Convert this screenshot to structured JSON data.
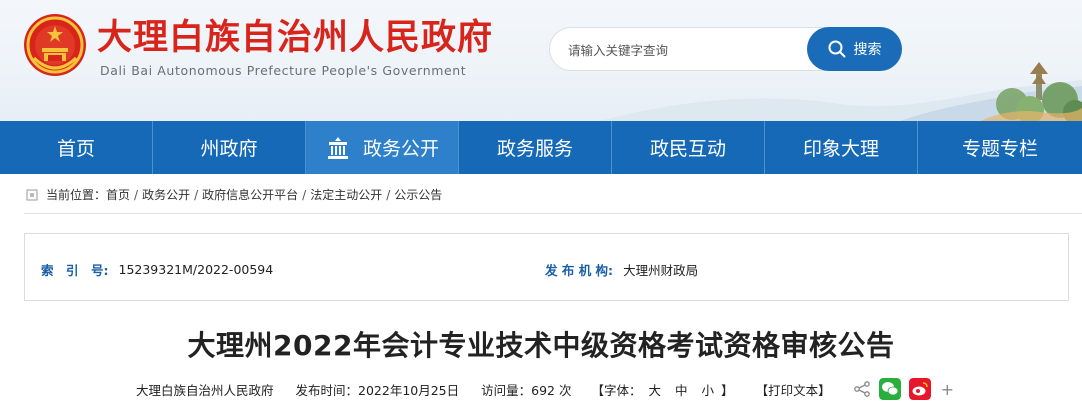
{
  "header": {
    "site_title": "大理白族自治州人民政府",
    "site_subtitle": "Dali Bai Autonomous Prefecture People's Government",
    "emblem_icon": "national-emblem-icon"
  },
  "search": {
    "placeholder": "请输入关键字查询",
    "button_label": "搜索",
    "icon": "search-icon"
  },
  "nav": {
    "items": [
      {
        "label": "首页"
      },
      {
        "label": "州政府"
      },
      {
        "label": "政务公开",
        "active": true,
        "icon": "government-building-icon"
      },
      {
        "label": "政务服务"
      },
      {
        "label": "政民互动"
      },
      {
        "label": "印象大理"
      },
      {
        "label": "专题专栏"
      }
    ]
  },
  "breadcrumb": {
    "prefix": "当前位置：",
    "items": [
      "首页",
      "政务公开",
      "政府信息公开平台",
      "法定主动公开",
      "公示公告"
    ],
    "separator": "/"
  },
  "info": {
    "index_label": "索　引　号:",
    "index_value": "15239321M/2022-00594",
    "publisher_label": "发 布 机 构:",
    "publisher_value": "大理州财政局"
  },
  "article": {
    "title": "大理州2022年会计专业技术中级资格考试资格审核公告",
    "source": "大理白族自治州人民政府",
    "publish_time": "发布时间：2022年10月25日",
    "views": "访问量：692 次",
    "font_prefix": "【字体：",
    "font_large": "大",
    "font_medium": "中",
    "font_small": "小",
    "font_suffix": "】",
    "print": "【打印文本】",
    "more": "+"
  },
  "colors": {
    "brand_red": "#d8251c",
    "nav_blue": "#1569b6",
    "nav_active": "#2d80c9",
    "label_blue": "#1a5fa8",
    "wechat_green": "#2aae3e",
    "weibo_red": "#e6162d"
  }
}
